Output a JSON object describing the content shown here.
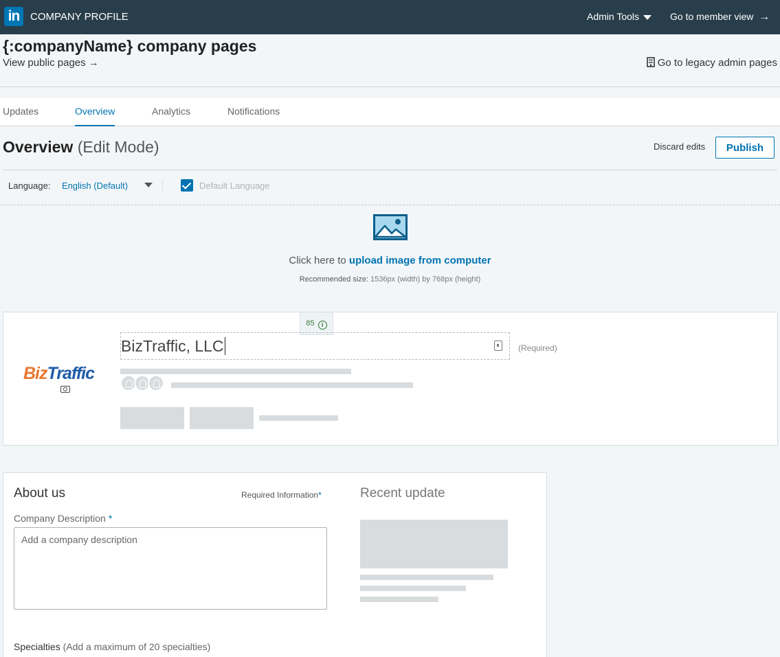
{
  "topbar": {
    "logo_text": "in",
    "title": "COMPANY PROFILE",
    "admin_tools": "Admin Tools",
    "member_view": "Go to member view",
    "member_view_arrow": "→",
    "bg_color": "#283e4a"
  },
  "header": {
    "page_title": "{:companyName} company pages",
    "view_public": "View public pages →",
    "legacy": "Go to legacy admin pages"
  },
  "tabs": [
    {
      "label": "Updates",
      "active": false
    },
    {
      "label": "Overview",
      "active": true
    },
    {
      "label": "Analytics",
      "active": false
    },
    {
      "label": "Notifications",
      "active": false
    }
  ],
  "overview": {
    "title": "Overview",
    "mode": "(Edit Mode)",
    "discard": "Discard edits",
    "publish": "Publish"
  },
  "language": {
    "label": "Language:",
    "value": "English (Default)",
    "default_checkbox_label": "Default Language",
    "default_checked": true
  },
  "cover": {
    "prefix": "Click here to ",
    "link": "upload image from computer",
    "rec_label": "Recommended size:",
    "rec_value": " 1536px (width) by 768px (height)"
  },
  "profile": {
    "char_count": "85",
    "company_name": "BizTraffic, LLC",
    "required": "(Required)",
    "logo_part1": "Biz",
    "logo_part2": "Traffic"
  },
  "about": {
    "title": "About us",
    "required_info": "Required Information",
    "required_star": "*",
    "desc_label": "Company Description",
    "desc_placeholder": "Add a company description",
    "desc_value": "",
    "specialties_label": "Specialties",
    "specialties_note": "(Add a maximum of 20 specialties)",
    "recent_title": "Recent update"
  },
  "colors": {
    "accent": "#0073b1",
    "page_bg": "#f3f6f8",
    "skeleton": "#d8dcde"
  }
}
